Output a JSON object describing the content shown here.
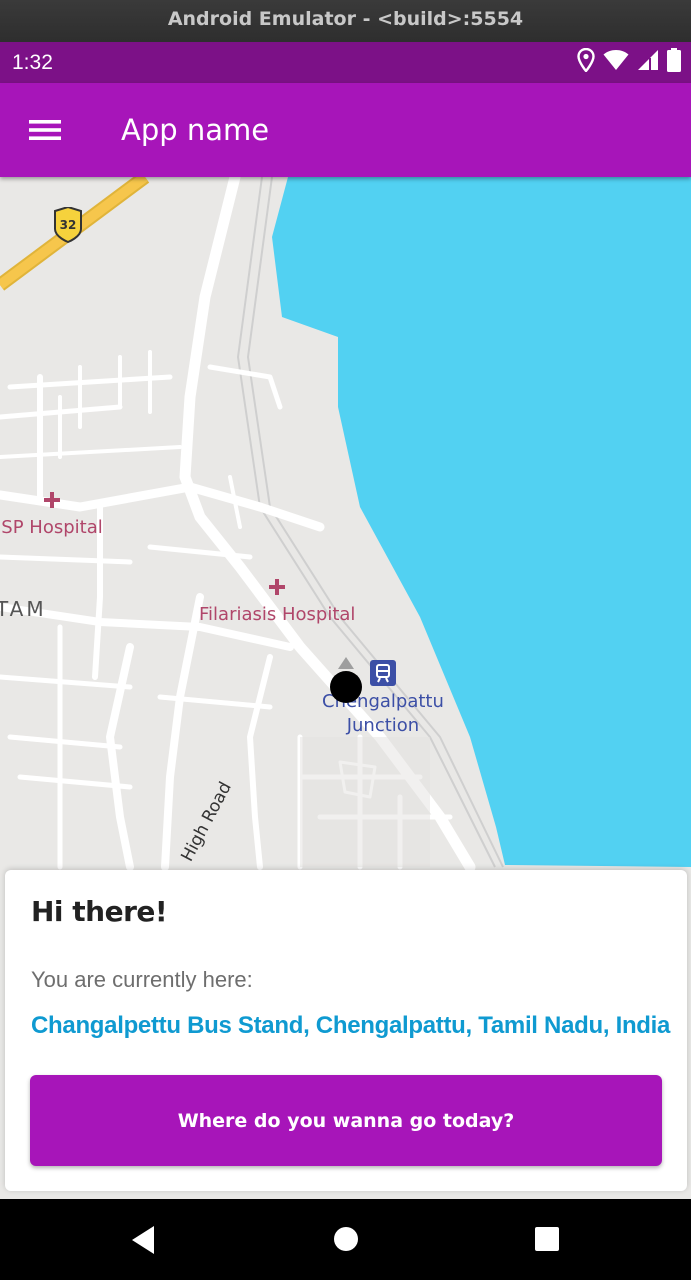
{
  "emulator": {
    "title": "Android Emulator - <build>:5554"
  },
  "status_bar": {
    "time": "1:32",
    "icons": [
      "location-icon",
      "wifi-icon",
      "signal-icon",
      "battery-icon"
    ]
  },
  "app_bar": {
    "menu_icon": "menu-icon",
    "title": "App name",
    "color": "#a715b9"
  },
  "map": {
    "route_shield": "32",
    "labels": {
      "hospital_1": "JSP Hospital",
      "hospital_2": "Filariasis Hospital",
      "area": "TAM",
      "junction_line1": "Chengalpattu",
      "junction_line2": "Junction",
      "road": "High Road"
    },
    "colors": {
      "water": "#52d1f2",
      "land": "#e9e8e6",
      "road": "#ffffff",
      "highway": "#f6c64c",
      "poi": "#b0466a",
      "transit": "#3c4fa6"
    }
  },
  "card": {
    "greeting": "Hi there!",
    "subtitle": "You are currently here:",
    "location": "Changalpettu Bus Stand, Chengalpattu, Tamil Nadu, India",
    "location_color": "#0f9ad1",
    "button_label": "Where do you wanna go today?"
  },
  "nav_bar": {
    "back": "back-icon",
    "home": "home-icon",
    "recents": "recents-icon"
  }
}
